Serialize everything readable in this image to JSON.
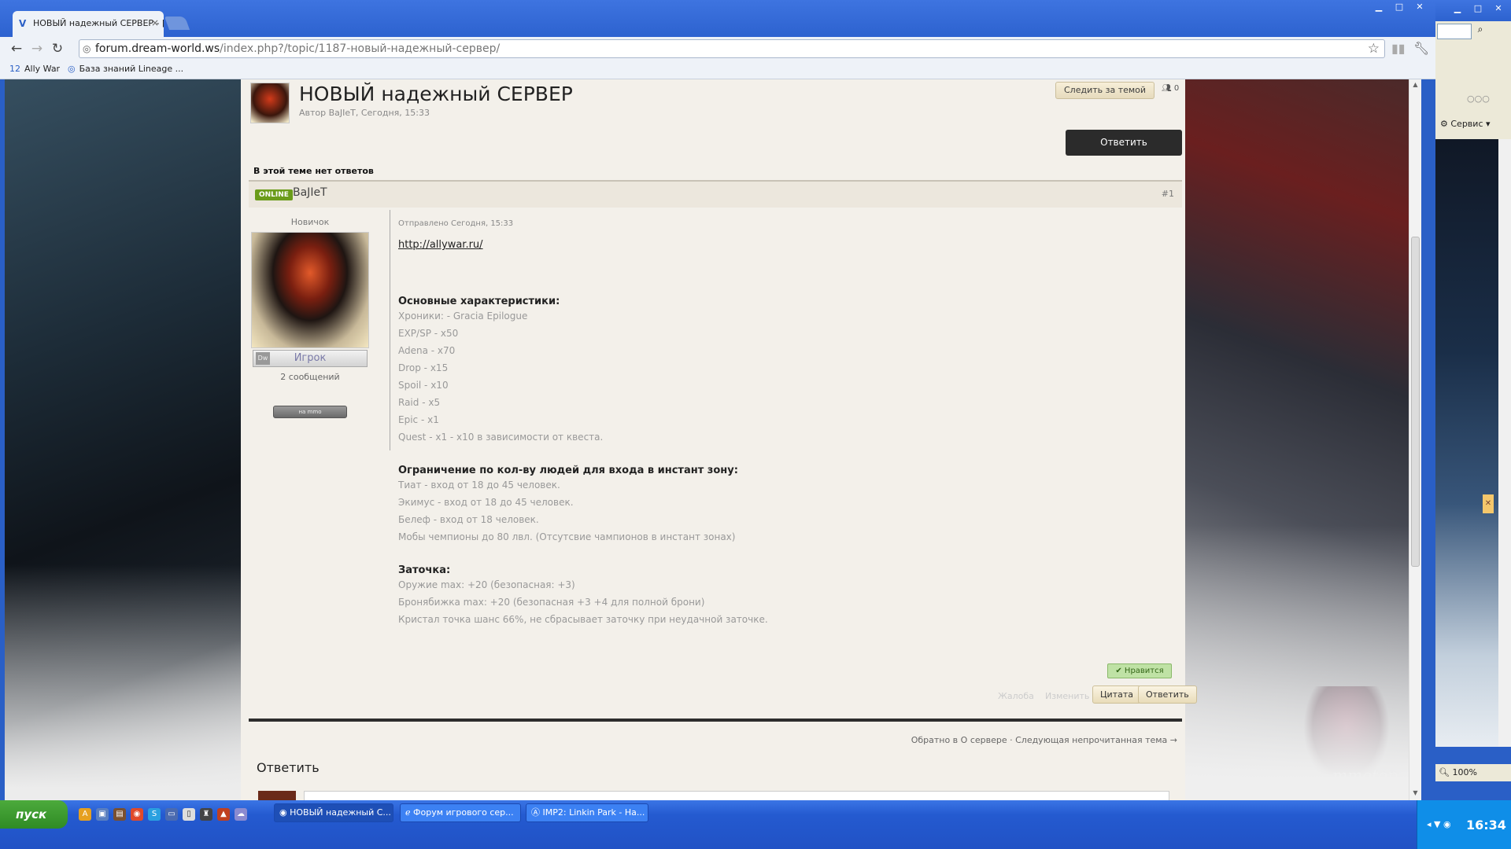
{
  "browser": {
    "tab_title": "НОВЫЙ надежный СЕРВЕР - [",
    "url_domain": "forum.dream-world.ws",
    "url_path": "/index.php?/topic/1187-новый-надежный-сервер/",
    "bookmarks": [
      {
        "label": "Ally War",
        "icon": "12"
      },
      {
        "label": "База знаний Lineage ...",
        "icon": "◎"
      }
    ]
  },
  "topic": {
    "title": "НОВЫЙ надежный СЕРВЕР",
    "meta": "Автор BaJIeT, Сегодня, 15:33",
    "follow_label": "Следить за темой",
    "followers_count": "0",
    "reply_label": "Ответить",
    "no_replies": "В этой теме нет ответов"
  },
  "post": {
    "status": "ONLINE",
    "author": "BaJIeT",
    "number": "#1",
    "rank": "Новичок",
    "group": "Игрок",
    "group_prefix": "Dw",
    "post_count": "2 сообщений",
    "vote_label": "на mmo",
    "date": "Отправлено Сегодня, 15:33",
    "link": "http://allywar.ru/",
    "sections": [
      {
        "title": "Основные характеристики:",
        "lines": [
          "Хроники: - Gracia Epilogue",
          "EXP/SP - x50",
          "Adena - x70",
          "Drop - x15",
          "Spoil - x10",
          "Raid - x5",
          "Epic - x1",
          "Quest - x1 - x10 в зависимости от квеста."
        ]
      },
      {
        "title": "Ограничение по кол-ву людей для входа в инстант зону:",
        "lines": [
          "Тиат - вход от 18 до 45 человек.",
          "Экимус - вход от 18 до 45 человек.",
          "Белеф - вход от 18 человек.",
          "Мобы чемпионы до 80 лвл. (Отсутсвие чампионов в инстант зонах)"
        ]
      },
      {
        "title": "Заточка:",
        "lines": [
          "Оружие max: +20 (безопасная: +3)",
          "Бронябижка max: +20 (безопасная +3 +4 для полной брони)",
          "Кристал точка шанс 66%, не сбрасывает заточку при неудачной заточке."
        ]
      }
    ],
    "like_label": "Нравится",
    "report_label": "Жалоба",
    "edit_label": "Изменить",
    "quote_label": "Цитата",
    "reply_label": "Ответить"
  },
  "footer": {
    "back_links": "Обратно в О сервере · Следующая непрочитанная тема →",
    "reply_heading": "Ответить"
  },
  "ie_window": {
    "service_label": "Сервис",
    "zoom": "100%"
  },
  "taskbar": {
    "start_label": "пуск",
    "tasks": [
      "НОВЫЙ надежный С...",
      "Форум игрового сер...",
      "IMP2: Linkin Park - На..."
    ],
    "clock": "16:34"
  },
  "colors": {
    "online": "#6b9c1a",
    "like": "#bfe2a5",
    "reply_button": "#2b2b2b"
  }
}
